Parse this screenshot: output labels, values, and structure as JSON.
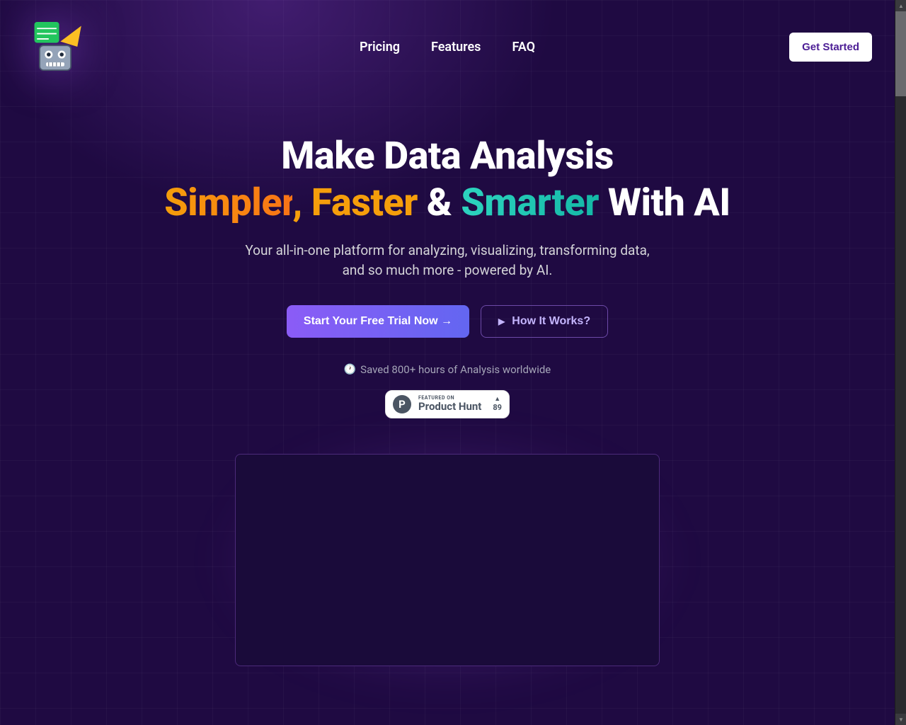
{
  "nav": {
    "pricing": "Pricing",
    "features": "Features",
    "faq": "FAQ",
    "get_started": "Get Started"
  },
  "hero": {
    "title_line1": "Make Data Analysis",
    "title_simpler": "Simpler",
    "title_comma": ", ",
    "title_faster": "Faster",
    "title_amp": " & ",
    "title_smarter": "Smarter",
    "title_with_ai": " With AI",
    "subtitle_line1": "Your all-in-one platform for analyzing, visualizing, transforming data,",
    "subtitle_line2": "and so much more - powered by AI.",
    "cta_primary": "Start Your Free Trial Now →",
    "cta_secondary": "How It Works?",
    "social_proof": "Saved 800+ hours of Analysis worldwide"
  },
  "product_hunt": {
    "featured_label": "FEATURED ON",
    "name": "Product Hunt",
    "votes": "89"
  }
}
